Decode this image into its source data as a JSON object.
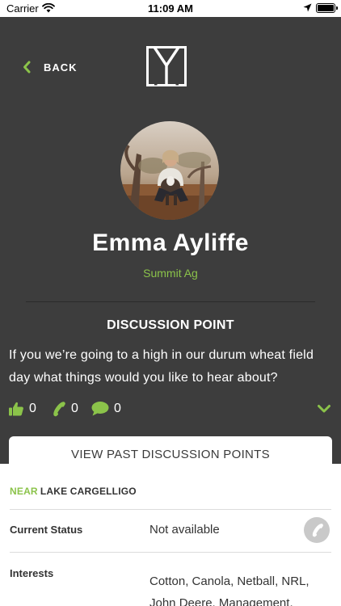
{
  "status_bar": {
    "carrier": "Carrier",
    "time": "11:09 AM"
  },
  "nav": {
    "back_label": "BACK",
    "logo_icon": "y-brand-logo"
  },
  "profile": {
    "name": "Emma Ayliffe",
    "company": "Summit Ag",
    "avatar_icon": "profile-photo"
  },
  "discussion": {
    "title": "DISCUSSION POINT",
    "text": "If you we’re going to a high in our durum wheat field day what things would you like to hear about?",
    "likes": "0",
    "calls": "0",
    "comments": "0",
    "view_past_label": "VIEW PAST DISCUSSION POINTS"
  },
  "info": {
    "near_key": "NEAR",
    "near_value": "LAKE CARGELLIGO",
    "status_label": "Current Status",
    "status_value": "Not available",
    "interests_label": "Interests",
    "interests_value": "Cotton, Canola, Netball, NRL, John Deere, Management,"
  },
  "colors": {
    "accent": "#8bc34a",
    "panel": "#3d3d3d"
  }
}
